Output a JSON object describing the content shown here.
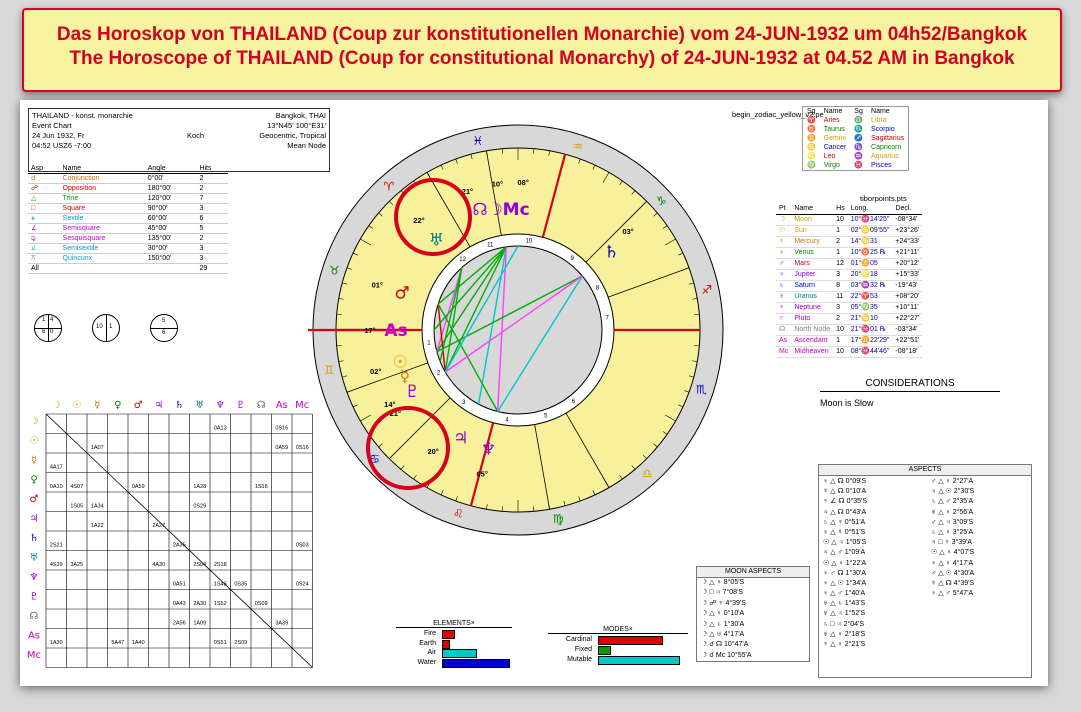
{
  "banner": {
    "line1": "Das Horoskop von THAILAND (Coup zur konstitutionellen Monarchie) vom 24-JUN-1932 um 04h52/Bangkok",
    "line2": "The Horoscope of THAILAND (Coup for constitutional Monarchy) of 24-JUN-1932 at 04.52 AM in Bangkok"
  },
  "info": {
    "name": "THAILAND - konst. monarchie",
    "place": "Bangkok, THAI",
    "type": "Event Chart",
    "coords": "13°N45' 100°E31'",
    "date": "24 Jun 1932, Fr",
    "house_system": "Koch",
    "zodiac": "Geocentric, Tropical",
    "time": "04:52 USZ6 -7:00",
    "node": "Mean Node"
  },
  "aspect_legend": {
    "headers": [
      "Asp",
      "Name",
      "Angle",
      "Hits"
    ],
    "rows": [
      {
        "glyph": "☌",
        "name": "Conjunction",
        "angle": "0°00'",
        "hits": "2",
        "color": "#c87800"
      },
      {
        "glyph": "☍",
        "name": "Opposition",
        "angle": "180°00'",
        "hits": "2",
        "color": "#e00000"
      },
      {
        "glyph": "△",
        "name": "Trine",
        "angle": "120°00'",
        "hits": "7",
        "color": "#009a00"
      },
      {
        "glyph": "□",
        "name": "Square",
        "angle": "90°00'",
        "hits": "3",
        "color": "#e00000"
      },
      {
        "glyph": "⚹",
        "name": "Sextile",
        "angle": "60°00'",
        "hits": "6",
        "color": "#00a0c8"
      },
      {
        "glyph": "∠",
        "name": "Semisquare",
        "angle": "45°00'",
        "hits": "5",
        "color": "#c800c8"
      },
      {
        "glyph": "⚼",
        "name": "Sesquisquare",
        "angle": "135°00'",
        "hits": "2",
        "color": "#c800c8"
      },
      {
        "glyph": "⚺",
        "name": "Semisextile",
        "angle": "30°00'",
        "hits": "3",
        "color": "#00a0c8"
      },
      {
        "glyph": "⚻",
        "name": "Quincunx",
        "angle": "150°00'",
        "hits": "3",
        "color": "#00a0c8"
      }
    ],
    "total_label": "All",
    "total": "29"
  },
  "mini_charts": [
    {
      "cells": [
        "1",
        "4",
        "6",
        "0"
      ]
    },
    {
      "cells": [
        "10",
        "1"
      ]
    },
    {
      "cells": [
        "5",
        "6"
      ]
    }
  ],
  "grid": {
    "header_glyphs": [
      "☽",
      "☉",
      "☿",
      "♀",
      "♂",
      "♃",
      "♄",
      "♅",
      "♆",
      "♇",
      "☊",
      "As",
      "Mc"
    ],
    "cells": [
      {
        "r": 0,
        "c": 8,
        "t": "0A13"
      },
      {
        "r": 0,
        "c": 11,
        "t": "0S16"
      },
      {
        "r": 1,
        "c": 2,
        "t": "1A07"
      },
      {
        "r": 1,
        "c": 11,
        "t": "0A59"
      },
      {
        "r": 1,
        "c": 12,
        "t": "0S16"
      },
      {
        "r": 2,
        "c": 0,
        "t": "4A17"
      },
      {
        "r": 3,
        "c": 0,
        "t": "0A10"
      },
      {
        "r": 3,
        "c": 1,
        "t": "4S07"
      },
      {
        "r": 3,
        "c": 4,
        "t": "0A59"
      },
      {
        "r": 3,
        "c": 7,
        "t": "1A28"
      },
      {
        "r": 3,
        "c": 10,
        "t": "1S16"
      },
      {
        "r": 4,
        "c": 1,
        "t": "1S05"
      },
      {
        "r": 4,
        "c": 2,
        "t": "1A34"
      },
      {
        "r": 4,
        "c": 7,
        "t": "0S29"
      },
      {
        "r": 5,
        "c": 2,
        "t": "1A22"
      },
      {
        "r": 5,
        "c": 5,
        "t": "2A27"
      },
      {
        "r": 6,
        "c": 0,
        "t": "2S21"
      },
      {
        "r": 6,
        "c": 6,
        "t": "2A35"
      },
      {
        "r": 6,
        "c": 12,
        "t": "0S03"
      },
      {
        "r": 7,
        "c": 0,
        "t": "4S39"
      },
      {
        "r": 7,
        "c": 1,
        "t": "3A25"
      },
      {
        "r": 7,
        "c": 5,
        "t": "4A30"
      },
      {
        "r": 7,
        "c": 7,
        "t": "2S04"
      },
      {
        "r": 7,
        "c": 8,
        "t": "2S18"
      },
      {
        "r": 8,
        "c": 6,
        "t": "0A51"
      },
      {
        "r": 8,
        "c": 8,
        "t": "1S43"
      },
      {
        "r": 8,
        "c": 9,
        "t": "0S35"
      },
      {
        "r": 8,
        "c": 12,
        "t": "0S24"
      },
      {
        "r": 9,
        "c": 6,
        "t": "0A43"
      },
      {
        "r": 9,
        "c": 7,
        "t": "2A30"
      },
      {
        "r": 9,
        "c": 8,
        "t": "1S52"
      },
      {
        "r": 9,
        "c": 10,
        "t": "0S09"
      },
      {
        "r": 10,
        "c": 6,
        "t": "2A56"
      },
      {
        "r": 10,
        "c": 7,
        "t": "1A09"
      },
      {
        "r": 10,
        "c": 11,
        "t": "3A39"
      },
      {
        "r": 11,
        "c": 0,
        "t": "1A30"
      },
      {
        "r": 11,
        "c": 3,
        "t": "5A47"
      },
      {
        "r": 11,
        "c": 4,
        "t": "1A40"
      },
      {
        "r": 11,
        "c": 8,
        "t": "0S51"
      },
      {
        "r": 11,
        "c": 9,
        "t": "2S09"
      }
    ]
  },
  "wheel": {
    "file_label": "begin_zodiac_yellow_v2.pe",
    "degree_labels": [
      {
        "t": "21°",
        "deg": 250
      },
      {
        "t": "10°",
        "deg": 262
      },
      {
        "t": "08°",
        "deg": 272
      },
      {
        "t": "03°",
        "deg": 318
      },
      {
        "t": "22°",
        "deg": 228
      },
      {
        "t": "01°",
        "deg": 198
      },
      {
        "t": "17°",
        "deg": 180
      },
      {
        "t": "02°",
        "deg": 164
      },
      {
        "t": "14°",
        "deg": 150
      },
      {
        "t": "21°",
        "deg": 146
      },
      {
        "t": "20°",
        "deg": 125
      },
      {
        "t": "05°",
        "deg": 104
      }
    ],
    "zodiac_glyphs": [
      "♈",
      "♉",
      "♊",
      "♋",
      "♌",
      "♍",
      "♎",
      "♏",
      "♐",
      "♑",
      "♒",
      "♓"
    ],
    "planet_glyphs": [
      {
        "g": "☊☽Mc",
        "deg": 262,
        "color": "#9400d3"
      },
      {
        "g": "♅",
        "deg": 228,
        "color": "#008080"
      },
      {
        "g": "♂",
        "deg": 198,
        "color": "#d00000"
      },
      {
        "g": "As",
        "deg": 180,
        "color": "#c800c8"
      },
      {
        "g": "☉",
        "deg": 165,
        "color": "#e0a000"
      },
      {
        "g": "☿",
        "deg": 158,
        "color": "#c87800"
      },
      {
        "g": "♇",
        "deg": 150,
        "color": "#9400d3"
      },
      {
        "g": "♃",
        "deg": 118,
        "color": "#9400d3"
      },
      {
        "g": "♆",
        "deg": 104,
        "color": "#9400d3"
      },
      {
        "g": "♄",
        "deg": 320,
        "color": "#0000c8"
      }
    ],
    "house_numbers": [
      "1",
      "2",
      "3",
      "4",
      "5",
      "6",
      "7",
      "8",
      "9",
      "10",
      "11",
      "12"
    ]
  },
  "zodiac_table": {
    "headers": [
      "Sg",
      "Name",
      "Sg",
      "Name"
    ],
    "rows": [
      {
        "g1": "♈",
        "n1": "Aries",
        "c1": "#d00000",
        "g2": "♎",
        "n2": "Libra",
        "c2": "#d0a000"
      },
      {
        "g1": "♉",
        "n1": "Taurus",
        "c1": "#008000",
        "g2": "♏",
        "n2": "Scorpio",
        "c2": "#0000c8"
      },
      {
        "g1": "♊",
        "n1": "Gemini",
        "c1": "#d0a000",
        "g2": "♐",
        "n2": "Sagittarius",
        "c2": "#d00000"
      },
      {
        "g1": "♋",
        "n1": "Cancer",
        "c1": "#0000c8",
        "g2": "♑",
        "n2": "Capricorn",
        "c2": "#008000"
      },
      {
        "g1": "♌",
        "n1": "Leo",
        "c1": "#d00000",
        "g2": "♒",
        "n2": "Aquarius",
        "c2": "#d0a000"
      },
      {
        "g1": "♍",
        "n1": "Virgo",
        "c1": "#008000",
        "g2": "♓",
        "n2": "Pisces",
        "c2": "#0000c8"
      }
    ]
  },
  "planet_table": {
    "file_label": "tiborpoints.pts",
    "headers": [
      "Pt",
      "Name",
      "Hs",
      "Long.",
      "Decl."
    ],
    "rows": [
      {
        "g": "☽",
        "name": "Moon",
        "hs": "10",
        "long": "10°♓14'25\"",
        "decl": "-08°34'",
        "color": "#c8a000"
      },
      {
        "g": "☉",
        "name": "Sun",
        "hs": "1",
        "long": "02°♋09'55\"",
        "decl": "+23°26'",
        "color": "#e0a000"
      },
      {
        "g": "☿",
        "name": "Mercury",
        "hs": "2",
        "long": "14°♋31",
        "decl": "+24°33'",
        "color": "#c87800"
      },
      {
        "g": "♀",
        "name": "Venus",
        "hs": "1",
        "long": "10°♉25 ℞",
        "decl": "+21°11'",
        "color": "#008000"
      },
      {
        "g": "♂",
        "name": "Mars",
        "hs": "12",
        "long": "01°♊05",
        "decl": "+20°12'",
        "color": "#d00000"
      },
      {
        "g": "♃",
        "name": "Jupiter",
        "hs": "3",
        "long": "20°♌18",
        "decl": "+15°33'",
        "color": "#9400d3"
      },
      {
        "g": "♄",
        "name": "Saturn",
        "hs": "8",
        "long": "03°♒32 ℞",
        "decl": "-19°43'",
        "color": "#0000c8"
      },
      {
        "g": "♅",
        "name": "Uranus",
        "hs": "11",
        "long": "22°♈53",
        "decl": "+08°20'",
        "color": "#008080"
      },
      {
        "g": "♆",
        "name": "Neptune",
        "hs": "3",
        "long": "05°♍35",
        "decl": "+10°11'",
        "color": "#9400d3"
      },
      {
        "g": "♇",
        "name": "Pluto",
        "hs": "2",
        "long": "21°♋10",
        "decl": "+22°27'",
        "color": "#9400d3"
      },
      {
        "g": "☊",
        "name": "North Node",
        "hs": "10",
        "long": "21°♓01 ℞",
        "decl": "-03°34'",
        "color": "#808080"
      },
      {
        "g": "As",
        "name": "Ascendant",
        "hs": "1",
        "long": "17°♊22'29\"",
        "decl": "+22°51'",
        "color": "#c800c8"
      },
      {
        "g": "Mc",
        "name": "Midheaven",
        "hs": "10",
        "long": "08°♓44'46\"",
        "decl": "-08°18'",
        "color": "#c800c8"
      }
    ]
  },
  "considerations": {
    "title": "CONSIDERATIONS",
    "text": "Moon is Slow"
  },
  "aspects": {
    "title": "ASPECTS",
    "col1": [
      "♀ △ ☊ 0°09'S",
      "☿ △ ☊ 0°10'A",
      "♆ ∠ ☊ 0°35'S",
      "♃ △ ☊ 0°43'A",
      "♄ △ ♆ 0°51'A",
      "♀ △ ☿ 0°51'S",
      "☉ △ ♃ 1°05'S",
      "♃ △ ♂ 1°09'A",
      "☉ △ ♀ 1°22'A",
      "♀ ♂ ☊ 1°30'A",
      "♀ △ ☉ 1°34'A",
      "♀ △ ♂ 1°40'A",
      "♅ △ ♄ 1°43'S",
      "♅ △ ♃ 1°52'S",
      "♄ □ ♃ 2°04'S",
      "♅ △ ♀ 2°18'S",
      "♆ △ ♀ 2°21'S"
    ],
    "col2": [
      "♂ △ ♀ 2°27'A",
      "♃ △ ☉ 2°30'S",
      "♄ △ ♂ 2°35'A",
      "♅ △ ♀ 2°56'A",
      "♂ △ ♃ 3°09'S",
      "♄ △ ♀ 3°25'A",
      "♃ □ ♆ 3°39'A",
      "☉ △ ♀ 4°07'S",
      "♀ △ ♀ 4°17'A",
      "♂ △ ☉ 4°30'A",
      "☿ △ ☊ 4°39'S",
      "♀ △ ♂ 5°47'A"
    ]
  },
  "moon_aspects": {
    "title": "MOON ASPECTS",
    "rows": [
      "☽ △ ♀ 8°05'S",
      "☽ □ ♃ 7°08'S",
      "☽ ☍ ♆ 4°39'S",
      "☽ △ ♀ 0°10'A",
      "☽ △ ♄ 1°30'A",
      "☽ △ ♅ 4°17'A",
      "☽ ☌ ☊ 10°47'A",
      "☽ ☌ Mc 10°55'A"
    ]
  },
  "elements": {
    "title": "ELEMENTS×",
    "rows": [
      {
        "label": "Fire",
        "value": 2,
        "color": "#e00000"
      },
      {
        "label": "Earth",
        "value": 1,
        "color": "#e00000"
      },
      {
        "label": "Air",
        "value": 6,
        "color": "#00c8c8"
      },
      {
        "label": "Water",
        "value": 12,
        "color": "#0000c8"
      }
    ]
  },
  "modes": {
    "title": "MODES×",
    "rows": [
      {
        "label": "Cardinal",
        "value": 11,
        "color": "#e00000"
      },
      {
        "label": "Fixed",
        "value": 2,
        "color": "#00a000"
      },
      {
        "label": "Mutable",
        "value": 14,
        "color": "#00c8c8"
      }
    ]
  }
}
